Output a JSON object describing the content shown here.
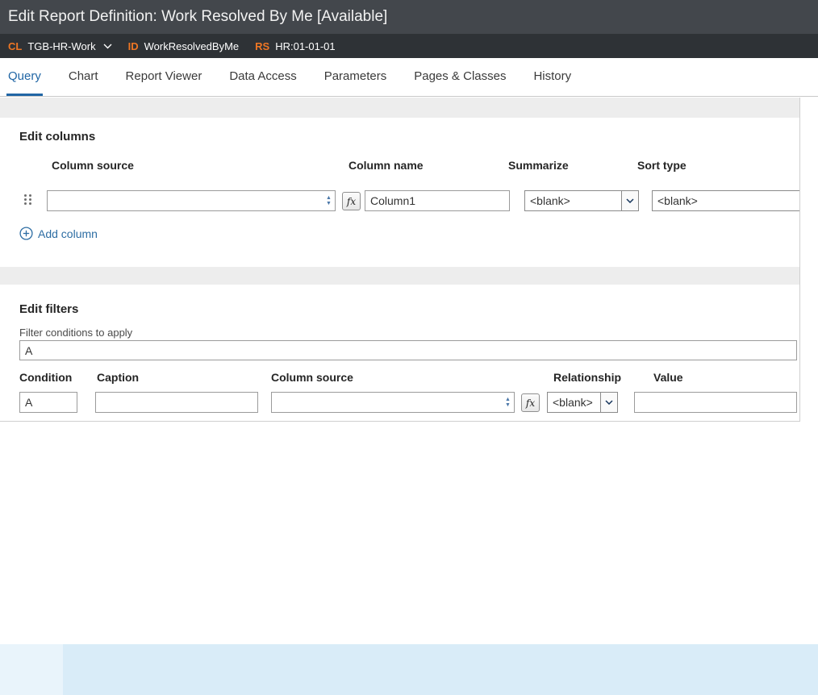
{
  "header": {
    "title": "Edit Report Definition: Work Resolved By Me [Available]",
    "meta": {
      "class_key": "CL",
      "class_value": "TGB-HR-Work",
      "id_key": "ID",
      "id_value": "WorkResolvedByMe",
      "ruleset_key": "RS",
      "ruleset_value": "HR:01-01-01"
    }
  },
  "tabs": [
    {
      "label": "Query"
    },
    {
      "label": "Chart"
    },
    {
      "label": "Report Viewer"
    },
    {
      "label": "Data Access"
    },
    {
      "label": "Parameters"
    },
    {
      "label": "Pages & Classes"
    },
    {
      "label": "History"
    }
  ],
  "edit_columns": {
    "heading": "Edit columns",
    "headers": {
      "column_source": "Column source",
      "column_name": "Column name",
      "summarize": "Summarize",
      "sort_type": "Sort type"
    },
    "row": {
      "column_source": "",
      "column_name": "Column1",
      "summarize": "<blank>",
      "sort_type": "<blank>"
    },
    "add_column_label": "Add column"
  },
  "edit_filters": {
    "heading": "Edit filters",
    "conditions_label": "Filter conditions to apply",
    "conditions_value": "A",
    "headers": {
      "condition": "Condition",
      "caption": "Caption",
      "column_source": "Column source",
      "relationship": "Relationship",
      "value": "Value"
    },
    "row": {
      "condition": "A",
      "caption": "",
      "column_source": "",
      "relationship": "<blank>",
      "value": ""
    }
  },
  "icons": {
    "fx": "fx",
    "stepper_up": "▲",
    "stepper_down": "▼"
  },
  "colors": {
    "titlebar_bg": "#43474c",
    "metabar_bg": "#2e3236",
    "accent_orange": "#ee7624",
    "link_blue": "#2d6da3",
    "footer_blue": "#d9ecf8"
  }
}
